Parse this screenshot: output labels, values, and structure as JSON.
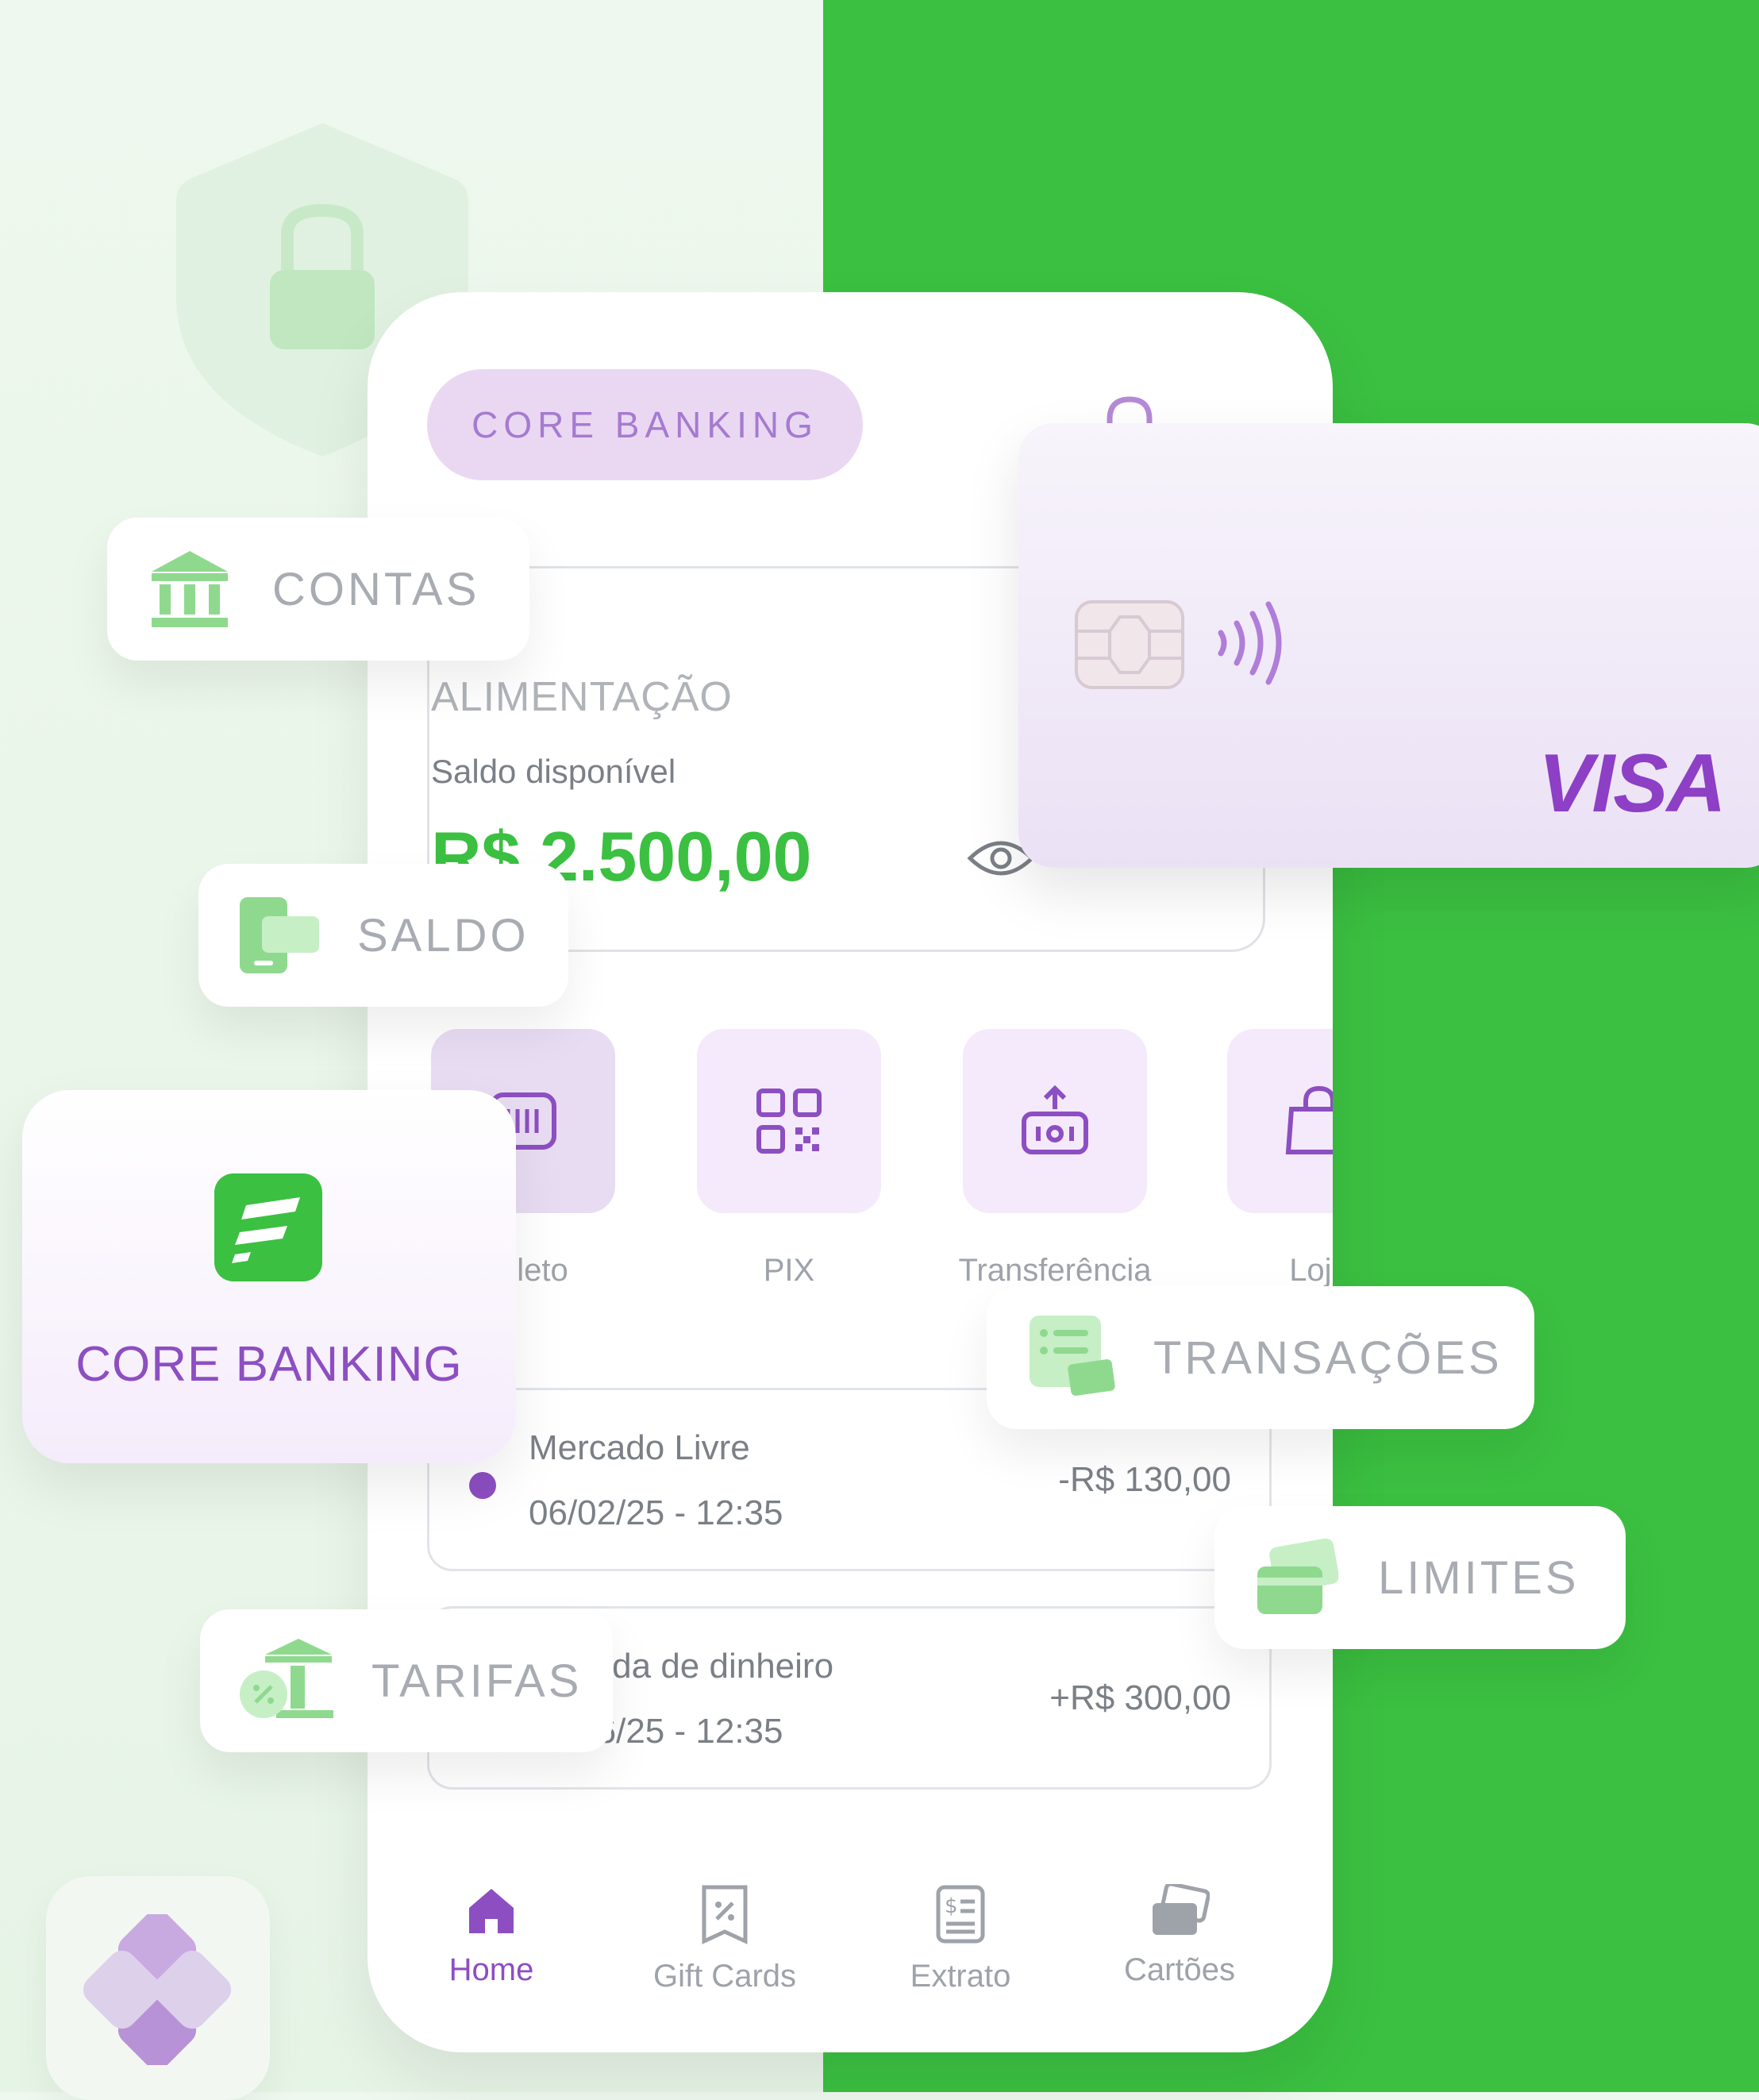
{
  "phone": {
    "header_pill": "CORE BANKING",
    "balance_card": {
      "label": "ALIMENTAÇÃO",
      "sub_label": "Saldo disponível",
      "value": "R$ 2.500,00"
    },
    "quick_actions": [
      {
        "label": "Boleto",
        "icon": "barcode-icon"
      },
      {
        "label": "PIX",
        "icon": "qr-code-icon"
      },
      {
        "label": "Transferência",
        "icon": "transfer-icon"
      },
      {
        "label": "Loja",
        "icon": "shopping-bag-icon"
      }
    ],
    "transactions": [
      {
        "title": "Mercado Livre",
        "date": "06/02/25 - 12:35",
        "amount": "-R$ 130,00"
      },
      {
        "title": "Entrada de dinheiro",
        "date": "06/06/25 - 12:35",
        "amount": "+R$ 300,00"
      }
    ],
    "nav": [
      {
        "label": "Home",
        "icon": "home-icon",
        "active": true
      },
      {
        "label": "Gift Cards",
        "icon": "gift-card-icon"
      },
      {
        "label": "Extrato",
        "icon": "statement-icon"
      },
      {
        "label": "Cartões",
        "icon": "cards-icon"
      }
    ]
  },
  "chips": {
    "contas": "CONTAS",
    "saldo": "SALDO",
    "transacoes": "TRANSAÇÕES",
    "limites": "LIMITES",
    "tarifas": "TARIFAS"
  },
  "card": {
    "brand": "VISA"
  },
  "core_tile": {
    "title": "CORE BANKING"
  },
  "colors": {
    "brand_green": "#3bc041",
    "brand_purple": "#8d4ec2",
    "light_purple": "#ead8f2"
  }
}
